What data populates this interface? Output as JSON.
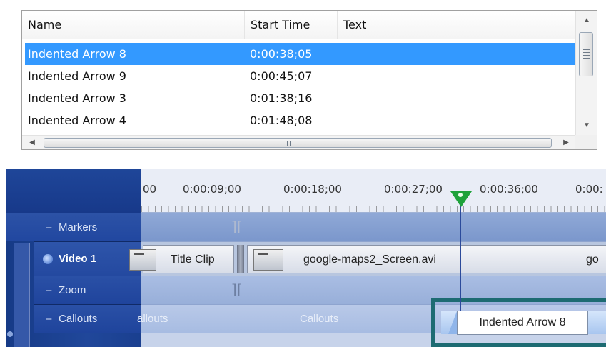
{
  "list": {
    "columns": [
      "Name",
      "Start Time",
      "Text"
    ],
    "rows": [
      {
        "name": "Indented Arrow 8",
        "start": "0:00:38;05",
        "text": "",
        "selected": true
      },
      {
        "name": "Indented Arrow 9",
        "start": "0:00:45;07",
        "text": "",
        "selected": false
      },
      {
        "name": "Indented Arrow 3",
        "start": "0:01:38;16",
        "text": "",
        "selected": false
      },
      {
        "name": "Indented Arrow 4",
        "start": "0:01:48;08",
        "text": "",
        "selected": false
      }
    ],
    "scroll_grip": "III"
  },
  "timeline": {
    "ruler_labels": [
      "00",
      "0:00:09;00",
      "0:00:18;00",
      "0:00:27;00",
      "0:00:36;00",
      "0:00:"
    ],
    "tracks": {
      "markers": "Markers",
      "video": "Video 1",
      "zoom": "Zoom",
      "callouts": "Callouts"
    },
    "video_clips": {
      "title_clip": "Title Clip",
      "screen_clip": "google-maps2_Screen.avi",
      "next_clip": "go"
    },
    "callout_ghosts": [
      "allouts",
      "Callouts"
    ],
    "selected_callout": "Indented Arrow 8",
    "colors": {
      "selection": "#3399ff",
      "sidebar": "#1a3f8f",
      "playhead": "#1ea23a",
      "selection_frame": "#1d6b72"
    }
  }
}
